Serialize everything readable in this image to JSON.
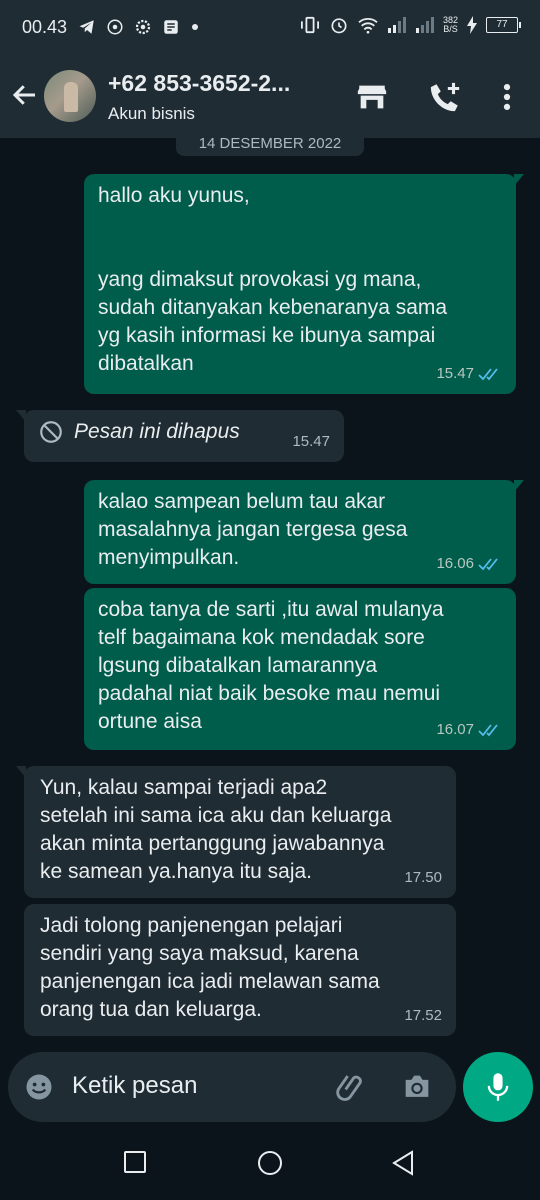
{
  "status_bar": {
    "time": "00.43",
    "net_speed_value": "382",
    "net_speed_unit": "B/S",
    "battery": "77"
  },
  "header": {
    "contact_name": "+62 853-3652-2...",
    "subtitle": "Akun bisnis"
  },
  "chat": {
    "date_chip": "14 Desember 2022",
    "messages": [
      {
        "direction": "outgoing",
        "text": "hallo aku yunus,\n\n\nyang dimaksut provokasi yg mana,\nsudah ditanyakan kebenaranya sama\nyg kasih informasi ke ibunya sampai\ndibatalkan",
        "time": "15.47",
        "read": true
      },
      {
        "direction": "incoming",
        "deleted": true,
        "text": "Pesan ini dihapus",
        "time": "15.47"
      },
      {
        "direction": "outgoing",
        "text": "kalao sampean belum tau akar\nmasalahnya jangan tergesa gesa\nmenyimpulkan.",
        "time": "16.06",
        "read": true
      },
      {
        "direction": "outgoing",
        "text": "coba tanya de sarti ,itu awal mulanya\ntelf bagaimana kok mendadak sore\nlgsung dibatalkan lamarannya\npadahal niat baik besoke mau nemui\nortune aisa",
        "time": "16.07",
        "read": true
      },
      {
        "direction": "incoming",
        "text": "Yun, kalau sampai terjadi apa2\nsetelah ini sama ica aku dan keluarga\nakan minta pertanggung jawabannya\nke samean ya.hanya itu saja.",
        "time": "17.50"
      },
      {
        "direction": "incoming",
        "text": "Jadi tolong panjenengan pelajari\nsendiri yang saya maksud, karena\npanjenengan ica jadi melawan sama\norang tua dan keluarga.",
        "time": "17.52"
      }
    ]
  },
  "composer": {
    "placeholder": "Ketik pesan"
  },
  "colors": {
    "outgoing_bubble": "#005c4b",
    "incoming_bubble": "#202c33",
    "accent": "#00a884",
    "read_tick": "#53bdeb",
    "background": "#0b141a"
  },
  "icons": [
    "back-arrow-icon",
    "shop-icon",
    "add-call-icon",
    "more-vert-icon",
    "block-icon",
    "double-check-icon",
    "emoji-icon",
    "paperclip-icon",
    "camera-icon",
    "mic-icon",
    "nav-recents-icon",
    "nav-home-icon",
    "nav-back-icon"
  ]
}
